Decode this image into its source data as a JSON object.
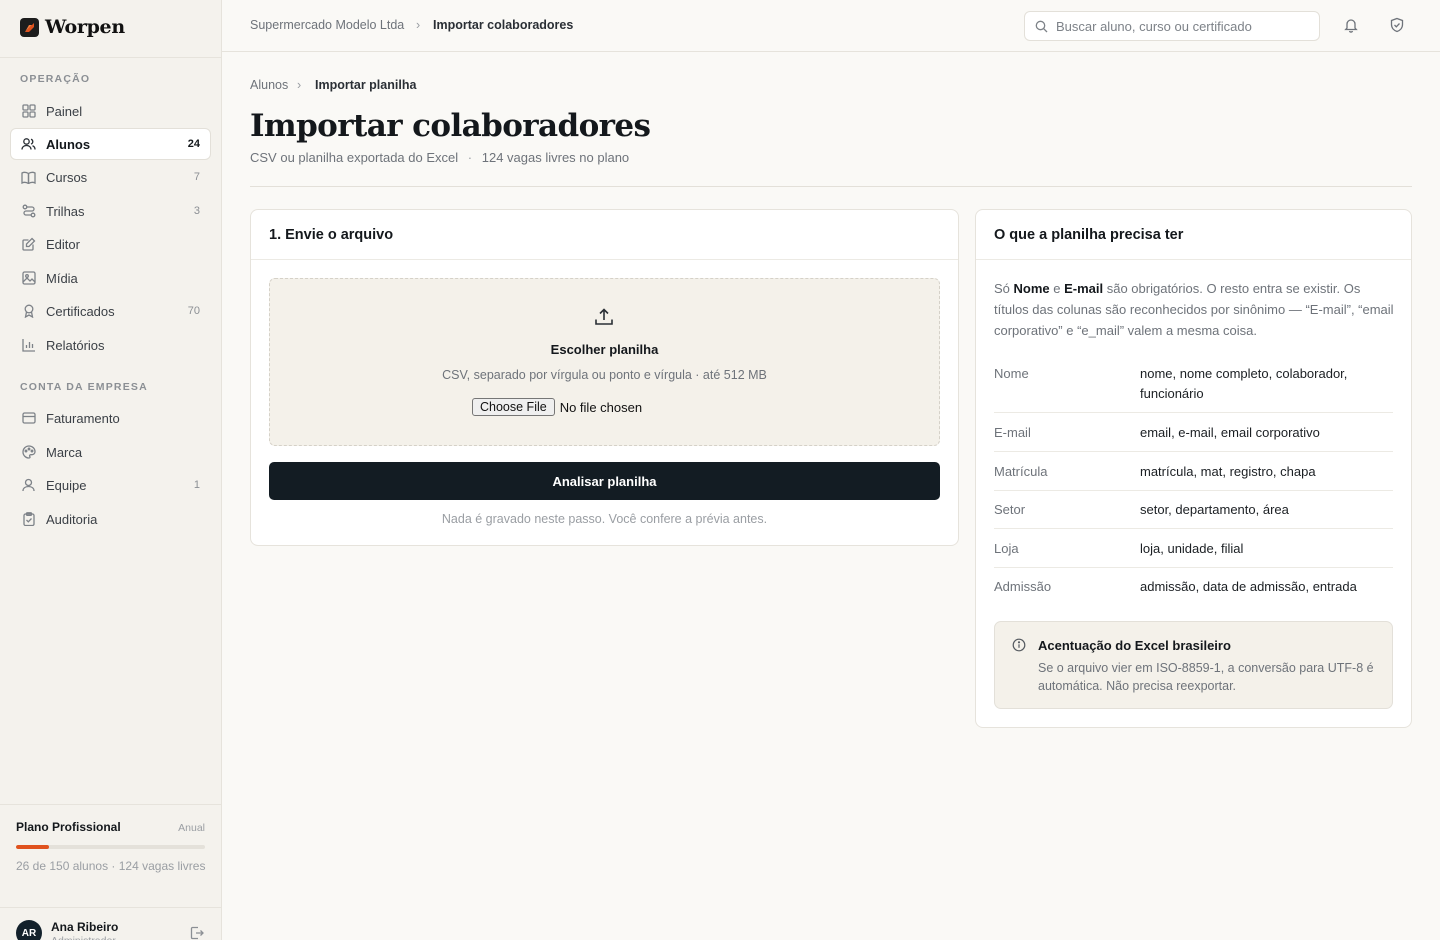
{
  "brand": {
    "name": "Worpen",
    "logo_color": "#e0521e"
  },
  "sidebar": {
    "section_operacao": "OPERAÇÃO",
    "section_conta": "CONTA DA EMPRESA",
    "items": [
      {
        "label": "Painel",
        "icon": "grid-icon",
        "count": ""
      },
      {
        "label": "Alunos",
        "icon": "users-icon",
        "count": "24",
        "active": true
      },
      {
        "label": "Cursos",
        "icon": "book-icon",
        "count": "7"
      },
      {
        "label": "Trilhas",
        "icon": "route-icon",
        "count": "3"
      },
      {
        "label": "Editor",
        "icon": "edit-icon",
        "count": ""
      },
      {
        "label": "Mídia",
        "icon": "image-icon",
        "count": ""
      },
      {
        "label": "Certificados",
        "icon": "award-icon",
        "count": "70"
      },
      {
        "label": "Relatórios",
        "icon": "bar-chart-icon",
        "count": ""
      }
    ],
    "account_items": [
      {
        "label": "Faturamento",
        "icon": "credit-card-icon",
        "count": ""
      },
      {
        "label": "Marca",
        "icon": "palette-icon",
        "count": ""
      },
      {
        "label": "Equipe",
        "icon": "user-icon",
        "count": "1"
      },
      {
        "label": "Auditoria",
        "icon": "clipboard-check-icon",
        "count": ""
      }
    ],
    "plan": {
      "title": "Plano Profissional",
      "period": "Anual",
      "usage_fraction": 0.173,
      "description": "26 de 150 alunos · 124 vagas livres"
    },
    "user": {
      "initials": "AR",
      "name": "Ana Ribeiro",
      "role": "Administrador"
    }
  },
  "topbar": {
    "breadcrumb_company": "Supermercado Modelo Ltda",
    "breadcrumb_current": "Importar colaboradores",
    "search_placeholder": "Buscar aluno, curso ou certificado"
  },
  "page": {
    "breadcrumb_parent": "Alunos",
    "breadcrumb_current": "Importar planilha",
    "title": "Importar colaboradores",
    "subtitle_format": "CSV ou planilha exportada do Excel",
    "subtitle_sep": "·",
    "subtitle_slots": "124 vagas livres no plano"
  },
  "upload_card": {
    "title": "1. Envie o arquivo",
    "dropzone_title": "Escolher planilha",
    "dropzone_desc": "CSV, separado por vírgula ou ponto e vírgula · até 512 MB",
    "file_button": "Choose File",
    "file_status": "No file chosen",
    "submit_label": "Analisar planilha",
    "hint": "Nada é gravado neste passo. Você confere a prévia antes."
  },
  "requirements_card": {
    "title": "O que a planilha precisa ter",
    "intro_1": "Só ",
    "intro_bold_1": "Nome",
    "intro_2": " e ",
    "intro_bold_2": "E-mail",
    "intro_3": " são obrigatórios. O resto entra se existir. Os títulos das colunas são reconhecidos por sinônimo — “E-mail”, “email corporativo” e “e_mail” valem a mesma coisa.",
    "mappings": [
      {
        "field": "Nome",
        "synonyms": "nome, nome completo, colaborador, funcionário"
      },
      {
        "field": "E-mail",
        "synonyms": "email, e-mail, email corporativo"
      },
      {
        "field": "Matrícula",
        "synonyms": "matrícula, mat, registro, chapa"
      },
      {
        "field": "Setor",
        "synonyms": "setor, departamento, área"
      },
      {
        "field": "Loja",
        "synonyms": "loja, unidade, filial"
      },
      {
        "field": "Admissão",
        "synonyms": "admissão, data de admissão, entrada"
      }
    ],
    "note_title": "Acentuação do Excel brasileiro",
    "note_text": "Se o arquivo vier em ISO-8859-1, a conversão para UTF-8 é automática. Não precisa reexportar."
  }
}
